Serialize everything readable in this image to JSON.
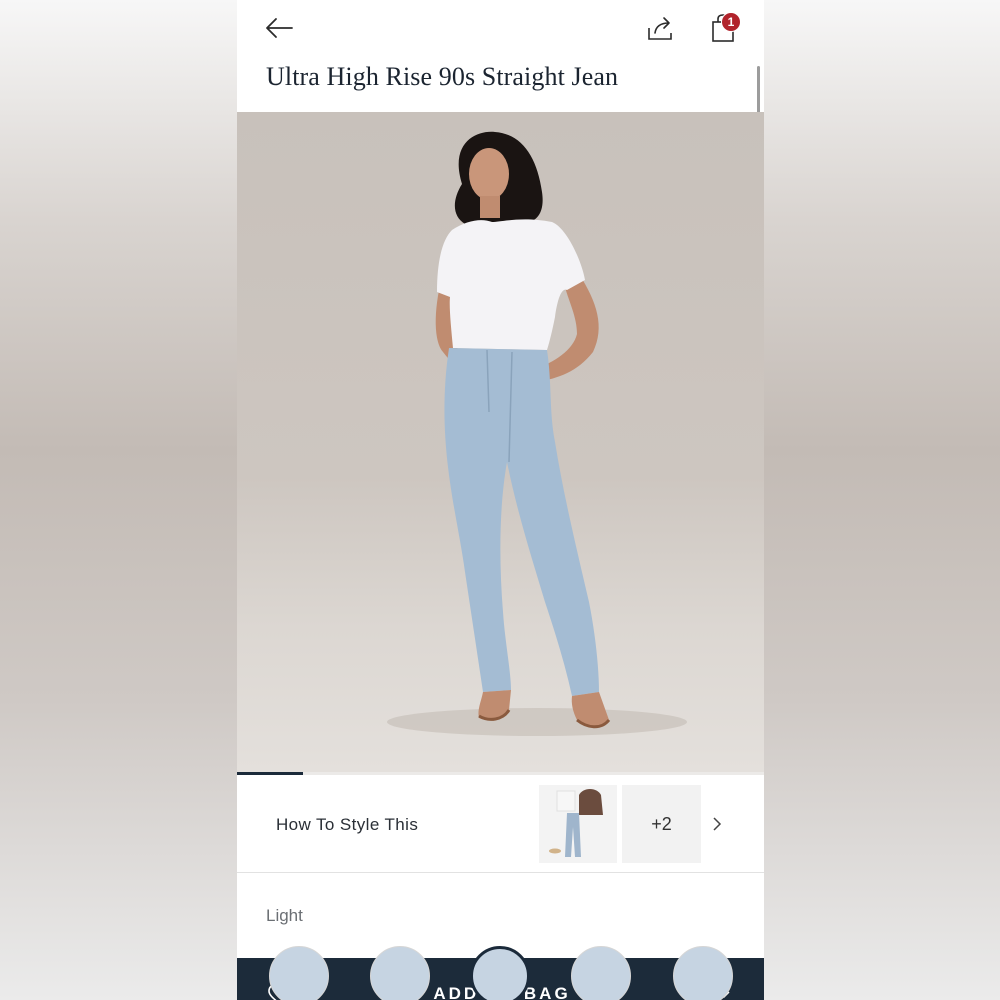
{
  "header": {
    "back_icon": "arrow-left-icon",
    "share_icon": "share-icon",
    "bag_icon": "shopping-bag-icon",
    "bag_count": "1",
    "product_title": "Ultra High Rise 90s Straight Jean"
  },
  "gallery": {
    "image_description": "model-wearing-jeans-photo",
    "progress": 0.125
  },
  "style_section": {
    "label": "How To Style This",
    "more_count": "+2",
    "chevron_icon": "chevron-right-icon"
  },
  "color_section": {
    "label": "Light",
    "swatch_count": 5,
    "selected_index": 2
  },
  "purchase_bar": {
    "wishlist_icon": "heart-icon",
    "add_label": "ADD TO BAG",
    "quantity": "1",
    "qty_chevron_icon": "chevron-down-icon"
  },
  "colors": {
    "navy": "#1c2b3a",
    "badge_red": "#b1232b"
  }
}
